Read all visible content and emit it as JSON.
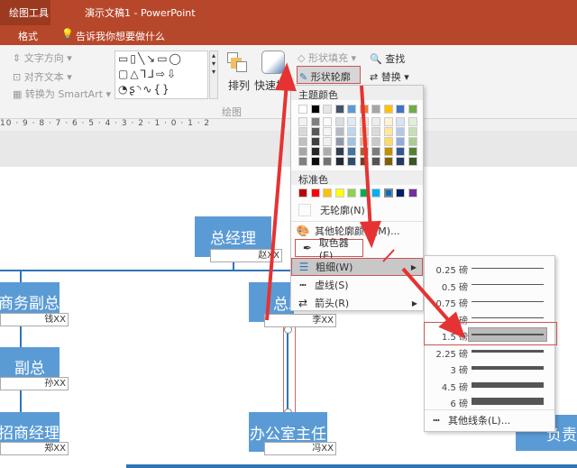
{
  "titlebar": {
    "tool_context": "绘图工具",
    "title": "演示文稿1 - PowerPoint"
  },
  "tabs": {
    "format": "格式",
    "tell_me": "告诉我你想要做什么"
  },
  "ribbon": {
    "text_direction": "文字方向",
    "align_text": "对齐文本",
    "convert_smartart": "转换为 SmartArt",
    "arrange": "排列",
    "quick_styles": "快速样式",
    "shape_fill": "形状填充",
    "shape_outline": "形状轮廓",
    "find": "查找",
    "replace": "替换",
    "group_drawing": "绘图"
  },
  "ruler": "10 · 9 · 8 · 7 · 6 · 5 · 4 · 3 · 2 · 1 · 0 · 1 · 2",
  "outline_menu": {
    "theme_colors": "主题颜色",
    "standard_colors": "标准色",
    "no_outline": "无轮廓(N)",
    "more_colors": "其他轮廓颜色(M)...",
    "eyedropper": "取色器(E)",
    "weight": "粗细(W)",
    "dashes": "虚线(S)",
    "arrows": "箭头(R)",
    "theme": [
      "#ffffff",
      "#000000",
      "#e7e6e6",
      "#44546a",
      "#5b9bd5",
      "#ed7d31",
      "#a5a5a5",
      "#ffc000",
      "#4472c4",
      "#70ad47"
    ],
    "standard": [
      "#c00000",
      "#ff0000",
      "#ffc000",
      "#ffff00",
      "#92d050",
      "#00b050",
      "#00b0f0",
      "#0070c0",
      "#002060",
      "#7030a0"
    ]
  },
  "weight_menu": {
    "items": [
      {
        "label": "0.25 磅",
        "pt": 0.25
      },
      {
        "label": "0.5 磅",
        "pt": 0.5
      },
      {
        "label": "0.75 磅",
        "pt": 0.75
      },
      {
        "label": "1 磅",
        "pt": 1
      },
      {
        "label": "1.5 磅",
        "pt": 1.5,
        "selected": true
      },
      {
        "label": "2.25 磅",
        "pt": 2.25
      },
      {
        "label": "3 磅",
        "pt": 3
      },
      {
        "label": "4.5 磅",
        "pt": 4.5
      },
      {
        "label": "6 磅",
        "pt": 6
      }
    ],
    "more_lines": "其他线条(L)..."
  },
  "org": {
    "gm": "总经理",
    "gm_name": "赵XX",
    "vp1": "商务副总",
    "vp1_name": "钱XX",
    "vp2": "副总",
    "vp2_name": "孙XX",
    "mgr": "招商经理",
    "mgr_name": "郑XX",
    "asst": "总助",
    "asst_name": "李XX",
    "office": "办公室主任",
    "office_name": "冯XX",
    "right": "负责"
  }
}
